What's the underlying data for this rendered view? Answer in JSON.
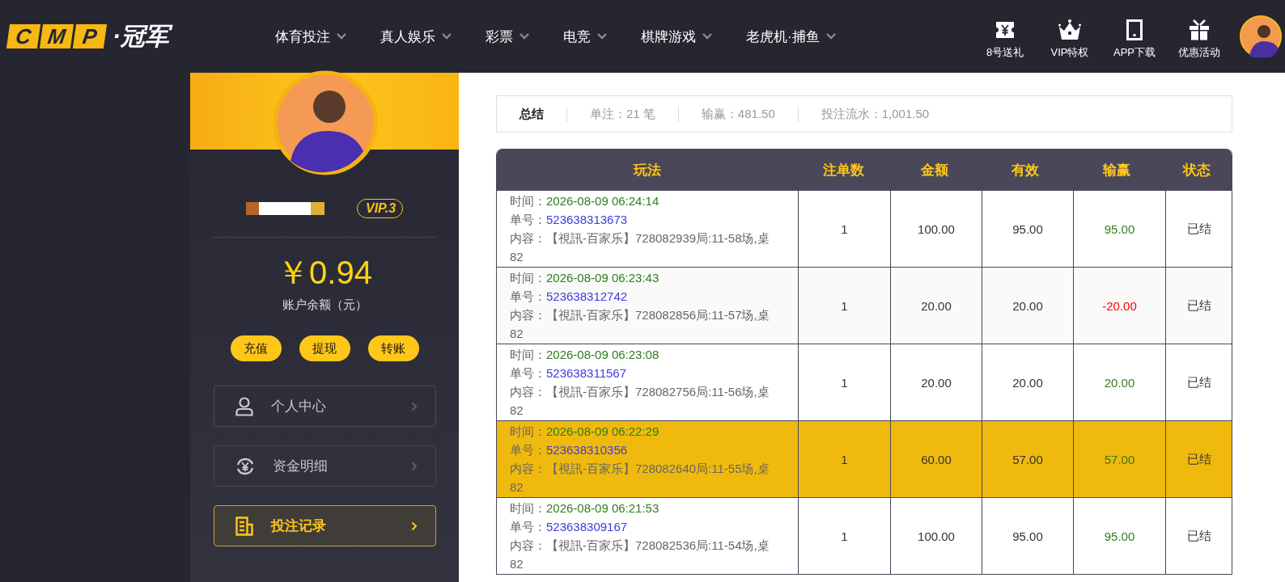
{
  "logo": {
    "letters": [
      "C",
      "M",
      "P"
    ],
    "name": "·冠军"
  },
  "nav": [
    {
      "label": "体育投注"
    },
    {
      "label": "真人娱乐"
    },
    {
      "label": "彩票"
    },
    {
      "label": "电竞"
    },
    {
      "label": "棋牌游戏"
    },
    {
      "label": "老虎机·捕鱼"
    }
  ],
  "quick_links": [
    {
      "label": "8号送礼",
      "kind": "coupon"
    },
    {
      "label": "VIP特权",
      "kind": "crown"
    },
    {
      "label": "APP下载",
      "kind": "tablet"
    },
    {
      "label": "优惠活动",
      "kind": "gift"
    }
  ],
  "profile": {
    "vip": "VIP.3",
    "balance": "￥0.94",
    "balance_label": "账户余额（元）",
    "actions": [
      "充值",
      "提现",
      "转账"
    ],
    "menu": [
      {
        "label": "个人中心",
        "kind": "person",
        "selected": false
      },
      {
        "label": "资金明细",
        "kind": "money",
        "selected": false
      },
      {
        "label": "投注记录",
        "kind": "record",
        "selected": true
      }
    ]
  },
  "summary": {
    "title": "总结",
    "items": [
      "单注：21 笔",
      "输赢：481.50",
      "投注流水：1,001.50"
    ]
  },
  "table": {
    "columns": [
      "玩法",
      "注单数",
      "金额",
      "有效",
      "输赢",
      "状态"
    ],
    "rows": [
      {
        "time_label": "时间：",
        "time": "2026-08-09 06:24:14",
        "order_label": "单号：",
        "order": "523638313673",
        "content_label": "内容：",
        "content": "【視訊-百家乐】728082939局:11-58场,桌82",
        "count": "1",
        "amount": "100.00",
        "valid": "95.00",
        "result": "95.00",
        "kind": "win",
        "status": "已结",
        "highlighted": false
      },
      {
        "time_label": "时间：",
        "time": "2026-08-09 06:23:43",
        "order_label": "单号：",
        "order": "523638312742",
        "content_label": "内容：",
        "content": "【視訊-百家乐】728082856局:11-57场,桌82",
        "count": "1",
        "amount": "20.00",
        "valid": "20.00",
        "result": "-20.00",
        "kind": "loss",
        "status": "已结",
        "highlighted": false
      },
      {
        "time_label": "时间：",
        "time": "2026-08-09 06:23:08",
        "order_label": "单号：",
        "order": "523638311567",
        "content_label": "内容：",
        "content": "【視訊-百家乐】728082756局:11-56场,桌82",
        "count": "1",
        "amount": "20.00",
        "valid": "20.00",
        "result": "20.00",
        "kind": "win",
        "status": "已结",
        "highlighted": false
      },
      {
        "time_label": "时间：",
        "time": "2026-08-09 06:22:29",
        "order_label": "单号：",
        "order": "523638310356",
        "content_label": "内容：",
        "content": "【視訊-百家乐】728082640局:11-55场,桌82",
        "count": "1",
        "amount": "60.00",
        "valid": "57.00",
        "result": "57.00",
        "kind": "win",
        "status": "已结",
        "highlighted": true
      },
      {
        "time_label": "时间：",
        "time": "2026-08-09 06:21:53",
        "order_label": "单号：",
        "order": "523638309167",
        "content_label": "内容：",
        "content": "【視訊-百家乐】728082536局:11-54场,桌82",
        "count": "1",
        "amount": "100.00",
        "valid": "95.00",
        "result": "95.00",
        "kind": "win",
        "status": "已结",
        "highlighted": false
      }
    ]
  }
}
